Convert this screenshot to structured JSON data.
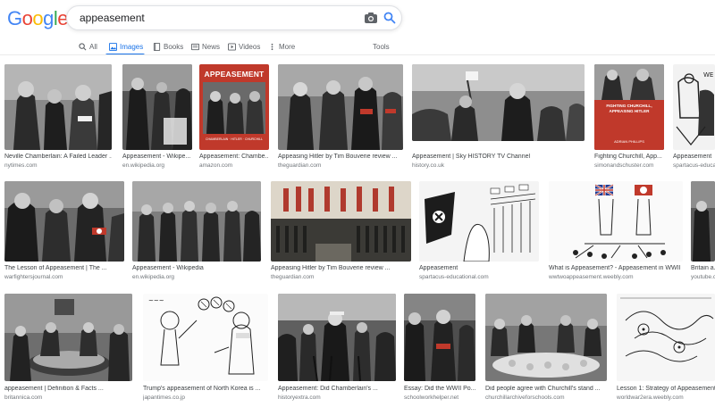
{
  "logo": "Google",
  "search": {
    "query": "appeasement"
  },
  "tabs": [
    {
      "label": "All"
    },
    {
      "label": "Images"
    },
    {
      "label": "Books"
    },
    {
      "label": "News"
    },
    {
      "label": "Videos"
    },
    {
      "label": "More"
    }
  ],
  "tools_label": "Tools",
  "colors": {
    "accent": "#1a73e8",
    "logo_blue": "#4285f4",
    "logo_red": "#ea4335",
    "logo_yellow": "#fbbc05",
    "logo_green": "#34a853"
  },
  "results": [
    {
      "title": "Neville Chamberlain: A Failed Leader ...",
      "source": "nytimes.com"
    },
    {
      "title": "Appeasement - Wikipe...",
      "source": "en.wikipedia.org"
    },
    {
      "title": "Appeasement: Chambe...",
      "source": "amazon.com",
      "cover_text": "APPEASEMENT",
      "cover_sub": "CHAMBERLAIN · HITLER · CHURCHILL"
    },
    {
      "title": "Appeasing Hitler by Tim Bouverie review ...",
      "source": "theguardian.com"
    },
    {
      "title": "Appeasement | Sky HISTORY TV Channel",
      "source": "history.co.uk"
    },
    {
      "title": "Fighting Churchill, App...",
      "source": "simonandschuster.com",
      "cover_text": "FIGHTING CHURCHILL, APPEASING HITLER",
      "cover_sub": "ADRIAN PHILLIPS"
    },
    {
      "title": "Appeasement",
      "source": "spartacus-educational..."
    },
    {
      "title": "The Lesson of Appeasement | The ...",
      "source": "warfightersjournal.com"
    },
    {
      "title": "Appeasement - Wikipedia",
      "source": "en.wikipedia.org"
    },
    {
      "title": "Appeasing Hitler by Tim Bouverie review ...",
      "source": "theguardian.com"
    },
    {
      "title": "Appeasement",
      "source": "spartacus-educational.com"
    },
    {
      "title": "What is Appeasement? - Appeasement in WWII",
      "source": "wwtwoappeasement.weebly.com"
    },
    {
      "title": "Britain a...",
      "source": "youtube.c..."
    },
    {
      "title": "appeasement | Definition & Facts ...",
      "source": "britannica.com"
    },
    {
      "title": "Trump's appeasement of North Korea is ...",
      "source": "japantimes.co.jp"
    },
    {
      "title": "Appeasement: Did Chamberlain's ...",
      "source": "historyextra.com"
    },
    {
      "title": "Essay: Did the WWII Po...",
      "source": "schoolworkhelper.net"
    },
    {
      "title": "Did people agree with Churchill's stand ...",
      "source": "churchillarchiveforschools.com"
    },
    {
      "title": "Lesson 1: Strategy of Appeasement ...",
      "source": "worldwar2era.weebly.com"
    }
  ]
}
